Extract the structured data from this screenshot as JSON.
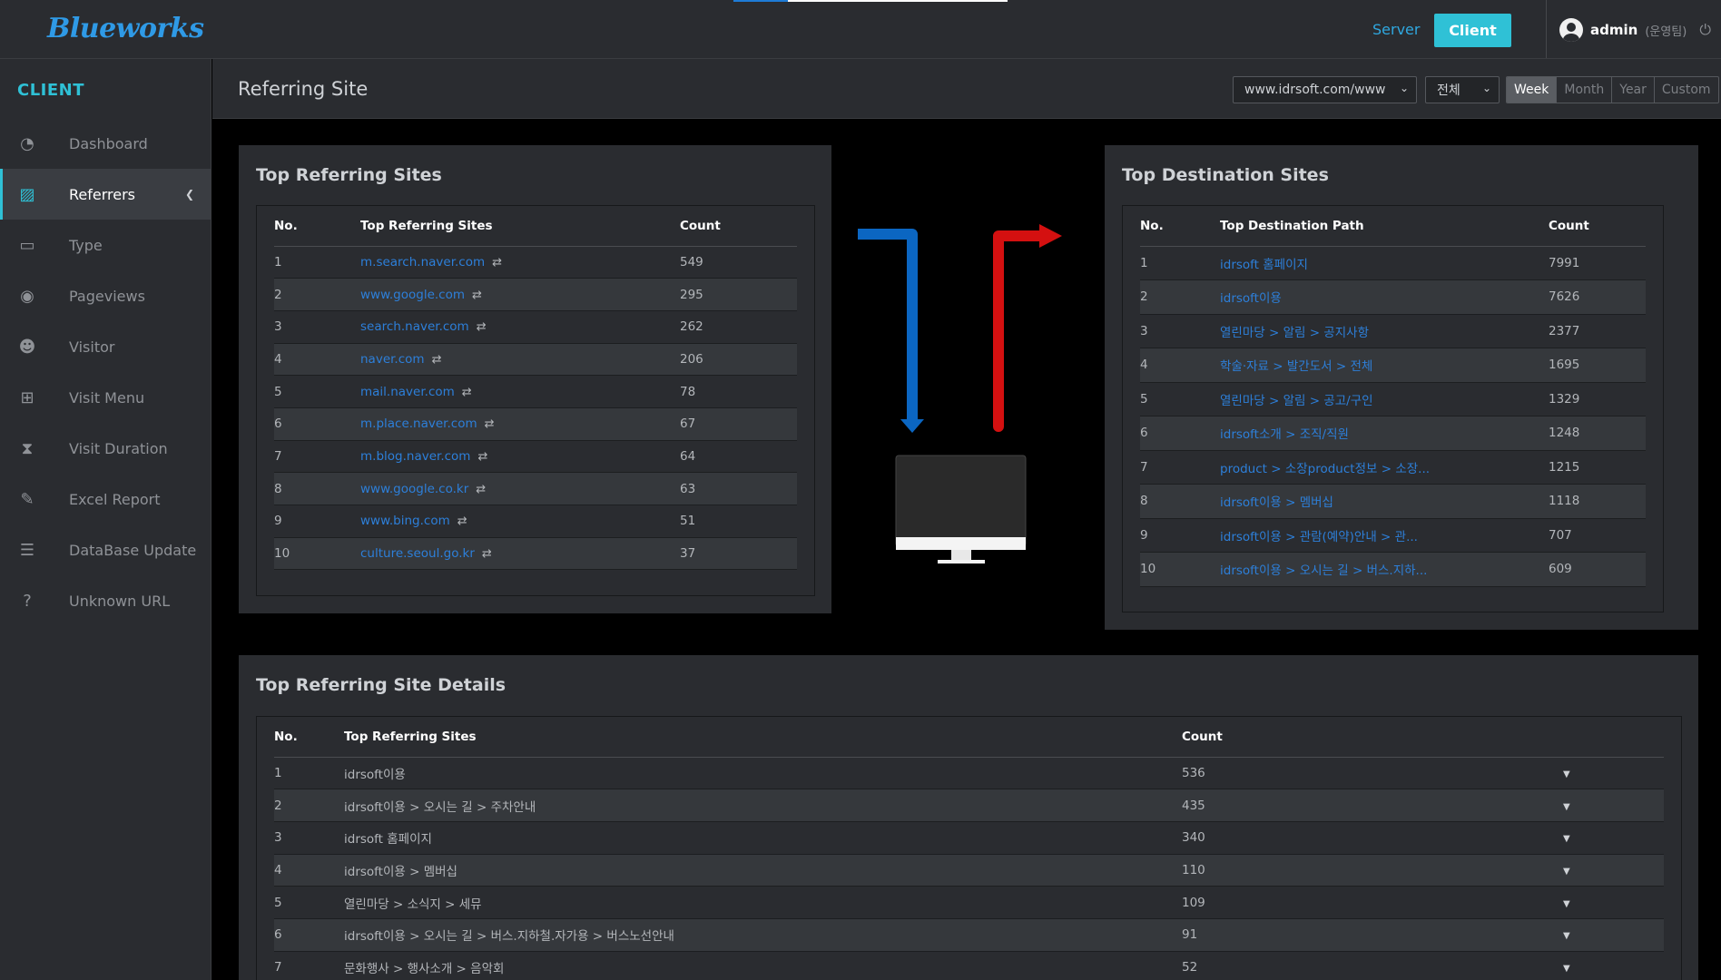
{
  "app": {
    "logo": "Blueworks"
  },
  "topnav": {
    "server": "Server",
    "client": "Client",
    "loading_progress": 0.2
  },
  "user": {
    "name": "admin",
    "role": "(운영팀)"
  },
  "sidebar": {
    "title": "CLIENT",
    "items": [
      {
        "label": "Dashboard",
        "icon": "gauge-icon"
      },
      {
        "label": "Referrers",
        "icon": "chart-icon"
      },
      {
        "label": "Type",
        "icon": "desktop-icon"
      },
      {
        "label": "Pageviews",
        "icon": "eye-icon"
      },
      {
        "label": "Visitor",
        "icon": "users-icon"
      },
      {
        "label": "Visit Menu",
        "icon": "sitemap-icon"
      },
      {
        "label": "Visit Duration",
        "icon": "hourglass-icon"
      },
      {
        "label": "Excel Report",
        "icon": "edit-icon"
      },
      {
        "label": "DataBase Update",
        "icon": "database-icon"
      },
      {
        "label": "Unknown URL",
        "icon": "question-icon"
      }
    ]
  },
  "header": {
    "title": "Referring Site",
    "site_select": "www.idrsoft.com/www",
    "scope_select": "전체",
    "periods": [
      "Week",
      "Month",
      "Year",
      "Custom"
    ]
  },
  "referring": {
    "title": "Top Referring Sites",
    "columns": [
      "No.",
      "Top Referring Sites",
      "Count"
    ],
    "rows": [
      {
        "no": "1",
        "site": "m.search.naver.com",
        "count": "549"
      },
      {
        "no": "2",
        "site": "www.google.com",
        "count": "295"
      },
      {
        "no": "3",
        "site": "search.naver.com",
        "count": "262"
      },
      {
        "no": "4",
        "site": "naver.com",
        "count": "206"
      },
      {
        "no": "5",
        "site": "mail.naver.com",
        "count": "78"
      },
      {
        "no": "6",
        "site": "m.place.naver.com",
        "count": "67"
      },
      {
        "no": "7",
        "site": "m.blog.naver.com",
        "count": "64"
      },
      {
        "no": "8",
        "site": "www.google.co.kr",
        "count": "63"
      },
      {
        "no": "9",
        "site": "www.bing.com",
        "count": "51"
      },
      {
        "no": "10",
        "site": "culture.seoul.go.kr",
        "count": "37"
      }
    ]
  },
  "destination": {
    "title": "Top Destination Sites",
    "columns": [
      "No.",
      "Top Destination Path",
      "Count"
    ],
    "rows": [
      {
        "no": "1",
        "path": "idrsoft 홈페이지",
        "count": "7991"
      },
      {
        "no": "2",
        "path": "idrsoft이용",
        "count": "7626"
      },
      {
        "no": "3",
        "path": "열린마당 > 알림 > 공지사항",
        "count": "2377"
      },
      {
        "no": "4",
        "path": "학술·자료 > 발간도서 > 전체",
        "count": "1695"
      },
      {
        "no": "5",
        "path": "열린마당 > 알림 > 공고/구인",
        "count": "1329"
      },
      {
        "no": "6",
        "path": "idrsoft소개 > 조직/직원",
        "count": "1248"
      },
      {
        "no": "7",
        "path": "product > 소장product정보 > 소장...",
        "count": "1215"
      },
      {
        "no": "8",
        "path": "idrsoft이용 > 멤버십",
        "count": "1118"
      },
      {
        "no": "9",
        "path": "idrsoft이용 > 관람(예약)안내 > 관...",
        "count": "707"
      },
      {
        "no": "10",
        "path": "idrsoft이용 > 오시는 길 > 버스.지하...",
        "count": "609"
      }
    ]
  },
  "details": {
    "title": "Top Referring Site Details",
    "columns": [
      "No.",
      "Top Referring Sites",
      "Count"
    ],
    "rows": [
      {
        "no": "1",
        "site": "idrsoft이용",
        "count": "536"
      },
      {
        "no": "2",
        "site": "idrsoft이용 > 오시는 길 > 주차안내",
        "count": "435"
      },
      {
        "no": "3",
        "site": "idrsoft 홈페이지",
        "count": "340"
      },
      {
        "no": "4",
        "site": "idrsoft이용 > 멤버십",
        "count": "110"
      },
      {
        "no": "5",
        "site": "열린마당 > 소식지 > 세뮤",
        "count": "109"
      },
      {
        "no": "6",
        "site": "idrsoft이용 > 오시는 길 > 버스.지하철.자가용 > 버스노선안내",
        "count": "91"
      },
      {
        "no": "7",
        "site": "문화행사 > 행사소개 > 음악회",
        "count": "52"
      }
    ]
  },
  "colors": {
    "accent": "#2fc1d6",
    "link": "#2d7fd9",
    "inbound_arrow": "#0b66c2",
    "outbound_arrow": "#d41010"
  }
}
